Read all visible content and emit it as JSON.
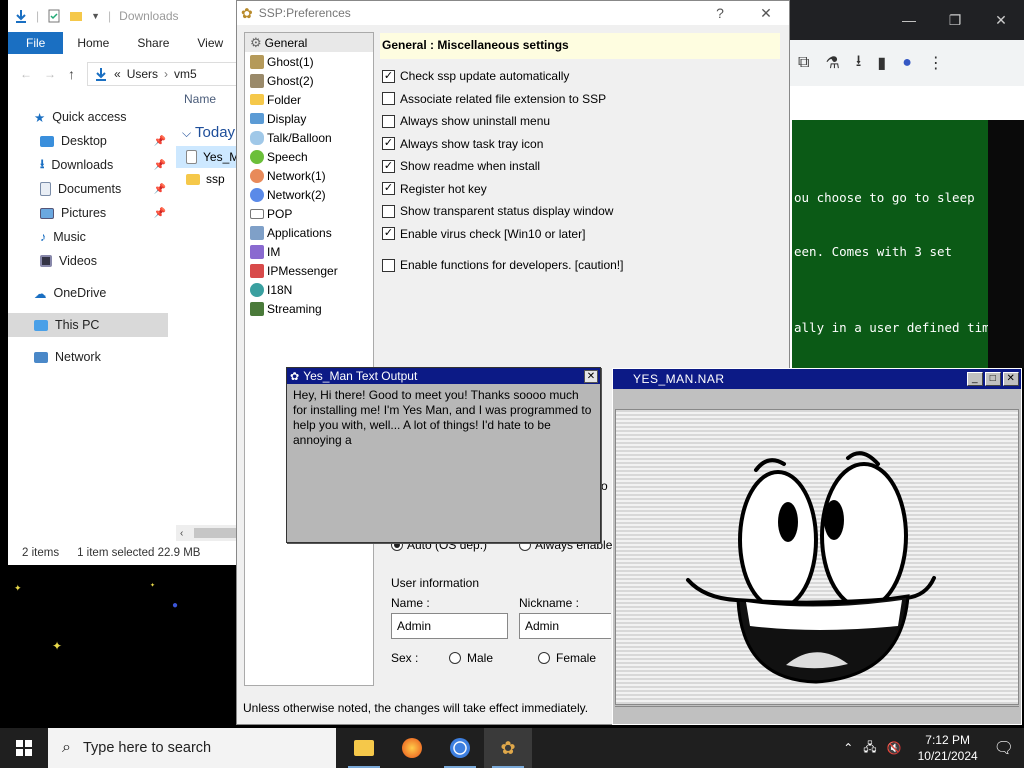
{
  "explorer": {
    "title": "Downloads",
    "ribbon_tabs": [
      "File",
      "Home",
      "Share",
      "View"
    ],
    "address": {
      "prefix": "«",
      "parts": [
        "Users",
        "vm5"
      ]
    },
    "nav": [
      {
        "label": "Quick access",
        "icon": "star-icon"
      },
      {
        "label": "Desktop",
        "icon": "desktop-icon",
        "pinned": true
      },
      {
        "label": "Downloads",
        "icon": "download-icon",
        "pinned": true
      },
      {
        "label": "Documents",
        "icon": "documents-icon",
        "pinned": true
      },
      {
        "label": "Pictures",
        "icon": "pictures-icon",
        "pinned": true
      },
      {
        "label": "Music",
        "icon": "music-icon"
      },
      {
        "label": "Videos",
        "icon": "videos-icon"
      },
      {
        "label": "OneDrive",
        "icon": "cloud-icon"
      },
      {
        "label": "This PC",
        "icon": "pc-icon",
        "selected": true
      },
      {
        "label": "Network",
        "icon": "network-icon"
      }
    ],
    "column_name": "Name",
    "group_label": "Today (",
    "files": [
      {
        "name": "Yes_Ma",
        "selected": true
      },
      {
        "name": "ssp",
        "selected": false
      }
    ],
    "status": {
      "count": "2 items",
      "selection": "1 item selected  22.9 MB"
    }
  },
  "chrome": {
    "lines": [
      "ou choose to go to sleep",
      "een. Comes with 3 set",
      "ally in a user defined time"
    ],
    "green_color": "#0b5a16"
  },
  "prefs": {
    "title": "SSP:Preferences",
    "tree": [
      "General",
      "Ghost(1)",
      "Ghost(2)",
      "Folder",
      "Display",
      "Talk/Balloon",
      "Speech",
      "Network(1)",
      "Network(2)",
      "POP",
      "Applications",
      "IM",
      "IPMessenger",
      "I18N",
      "Streaming"
    ],
    "section_title": "General : Miscellaneous settings",
    "options": [
      {
        "label": "Check ssp update automatically",
        "checked": true
      },
      {
        "label": "Associate related file extension to SSP",
        "checked": false
      },
      {
        "label": "Always show uninstall menu",
        "checked": false
      },
      {
        "label": "Always show task tray icon",
        "checked": true
      },
      {
        "label": "Show readme when install",
        "checked": true
      },
      {
        "label": "Register hot key",
        "checked": true
      },
      {
        "label": "Show transparent status display window",
        "checked": false
      },
      {
        "label": "Enable virus check [Win10 or later]",
        "checked": true
      },
      {
        "label": "Enable functions for developers. [caution!]",
        "checked": false
      }
    ],
    "partial_letter": "o",
    "radio_auto": "Auto (OS dep.)",
    "radio_always": "Always enable",
    "user_info_label": "User information",
    "name_label": "Name :",
    "nickname_label": "Nickname :",
    "name_value": "Admin",
    "nickname_value": "Admin",
    "sex_label": "Sex :",
    "male_label": "Male",
    "female_label": "Female",
    "footer": "Unless otherwise noted, the changes will take effect immediately."
  },
  "textout": {
    "title": "Yes_Man Text Output",
    "body": "Hey, Hi there! Good to meet you! Thanks soooo much for installing me! I'm Yes Man, and I was programmed to help you with, well... A lot of things! I'd hate to be annoying a"
  },
  "nar": {
    "title": "YES_MAN.NAR"
  },
  "taskbar": {
    "search_placeholder": "Type here to search",
    "time": "7:12 PM",
    "date": "10/21/2024",
    "apps": [
      "file-explorer-icon",
      "firefox-icon",
      "chrome-icon",
      "ssp-icon"
    ]
  },
  "colors": {
    "titlebar_blue": "#0c1a86",
    "file_tab": "#1a6fc2"
  }
}
